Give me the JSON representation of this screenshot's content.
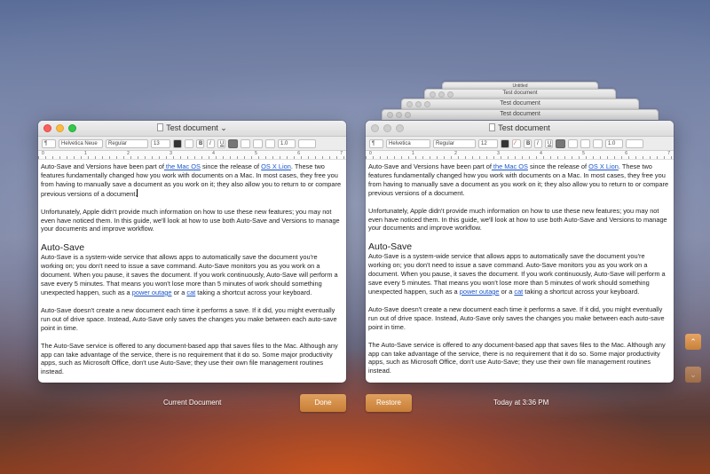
{
  "left_window": {
    "title": "Test document",
    "toolbar": {
      "paragraph_style": "¶",
      "font_family": "Helvetica Neue",
      "font_style": "Regular",
      "font_size": "13",
      "bold": "B",
      "italic": "I",
      "underline": "U",
      "spacing": "1.0"
    },
    "ruler": [
      "0",
      "1",
      "2",
      "3",
      "4",
      "5",
      "6",
      "7"
    ]
  },
  "right_window": {
    "title": "Test document",
    "toolbar": {
      "paragraph_style": "¶",
      "font_family": "Helvetica",
      "font_style": "Regular",
      "font_size": "12",
      "bold": "B",
      "italic": "I",
      "underline": "U",
      "spacing": "1.0"
    },
    "ruler": [
      "0",
      "1",
      "2",
      "3",
      "4",
      "5",
      "6",
      "7"
    ]
  },
  "version_stack": [
    "Untitled",
    "Test document",
    "Test document",
    "Test document"
  ],
  "document": {
    "p1": {
      "a": "Auto-Save and Versions have been part of",
      "link1": " the Mac OS",
      "b": " since the release of ",
      "link2": "OS X Lion",
      "c": ". These two features fundamentally changed how you work with documents on a Mac. In most cases, they free you from having to manually save a document as you work on it; they also allow you to return to or compare previous versions of a document."
    },
    "p2": "Unfortunately, Apple didn't provide much information on how to use these new features; you may not even have noticed them. In this guide, we'll look at how to use both Auto-Save and Versions to manage your documents and improve workflow.",
    "heading": "Auto-Save",
    "p3": {
      "a": "Auto-Save is a system-wide service that allows apps to automatically save the document you're working on; you don't need to issue a save command. Auto-Save monitors you as you work on a document. When you pause, it saves the document. If you work continuously, Auto-Save will perform a save every 5 minutes. That means you won't lose more than 5 minutes of work should something unexpected happen, such as a ",
      "link1": "power outage",
      "b": " or a ",
      "link2": "cat",
      "c": " taking a shortcut across your keyboard."
    },
    "p4": "Auto-Save doesn't create a new document each time it performs a save. If it did, you might eventually run out of drive space. Instead, Auto-Save only saves the changes you make between each auto-save point in time.",
    "p5": "The Auto-Save service is offered to any document-based app that saves files to the Mac. Although any app can take advantage of the service, there is no requirement that it do so. Some major productivity apps, such as Microsoft Office, don't use Auto-Save; they use their own file management routines instead."
  },
  "footer": {
    "current_label": "Current Document",
    "done_label": "Done",
    "restore_label": "Restore",
    "version_time": "Today at 3:36 PM"
  },
  "nav": {
    "up_arrow": "⌃",
    "down_arrow": "⌄"
  },
  "colors": {
    "accent": "#d28b45",
    "link": "#1a55c9"
  }
}
